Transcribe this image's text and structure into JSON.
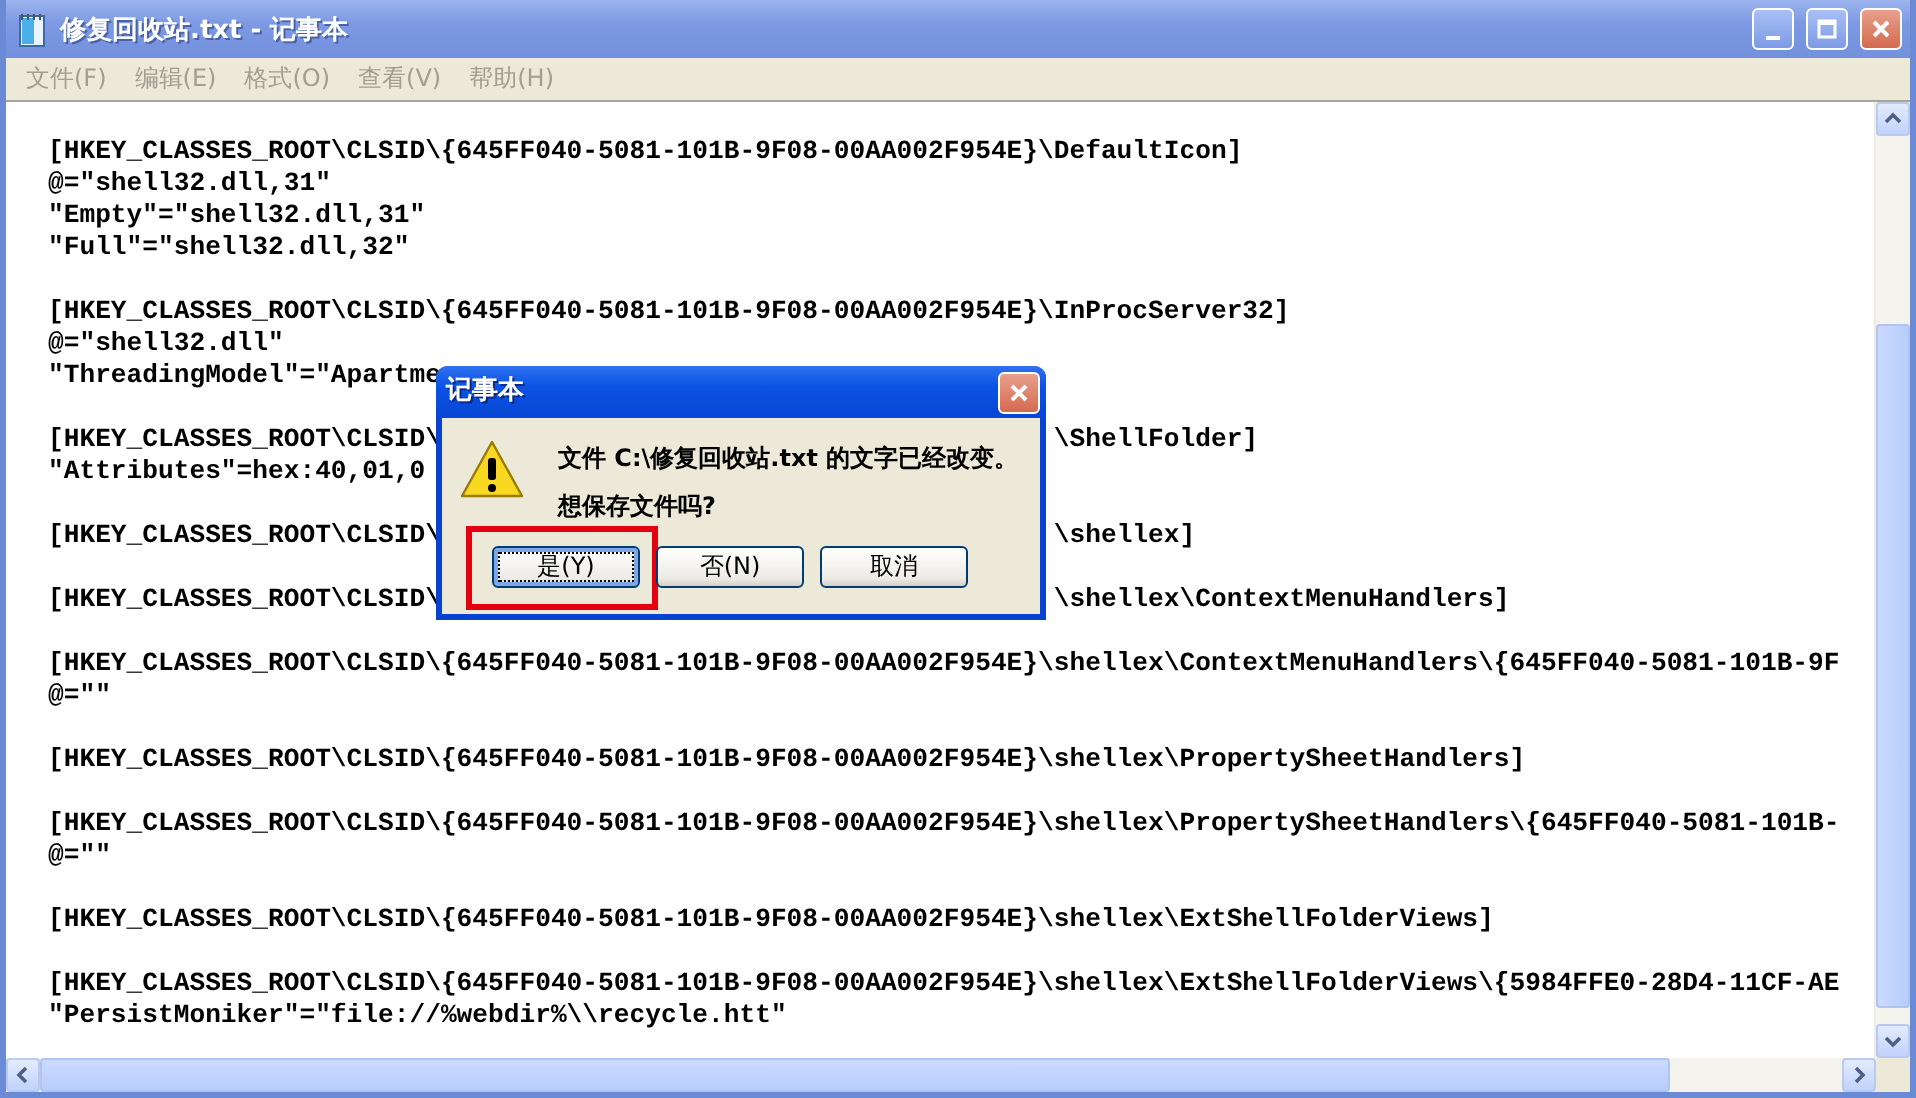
{
  "window": {
    "title": "修复回收站.txt - 记事本"
  },
  "menu": [
    {
      "label": "文件(F)"
    },
    {
      "label": "编辑(E)"
    },
    {
      "label": "格式(O)"
    },
    {
      "label": "查看(V)"
    },
    {
      "label": "帮助(H)"
    }
  ],
  "editor": {
    "lines": [
      {
        "kind": "full",
        "text": "[HKEY_CLASSES_ROOT\\CLSID\\{645FF040-5081-101B-9F08-00AA002F954E}\\DefaultIcon]"
      },
      {
        "kind": "full",
        "text": "@=\"shell32.dll,31\""
      },
      {
        "kind": "full",
        "text": "\"Empty\"=\"shell32.dll,31\""
      },
      {
        "kind": "full",
        "text": "\"Full\"=\"shell32.dll,32\""
      },
      {
        "kind": "blank"
      },
      {
        "kind": "full",
        "text": "[HKEY_CLASSES_ROOT\\CLSID\\{645FF040-5081-101B-9F08-00AA002F954E}\\InProcServer32]"
      },
      {
        "kind": "full",
        "text": "@=\"shell32.dll\""
      },
      {
        "kind": "split",
        "left": "\"ThreadingModel\"=\"Apartme"
      },
      {
        "kind": "blank"
      },
      {
        "kind": "split",
        "left": "[HKEY_CLASSES_ROOT\\CLSID\\",
        "right": "\\ShellFolder]"
      },
      {
        "kind": "split",
        "left": "\"Attributes\"=hex:40,01,0"
      },
      {
        "kind": "blank"
      },
      {
        "kind": "split",
        "left": "[HKEY_CLASSES_ROOT\\CLSID\\",
        "right": "\\shellex]"
      },
      {
        "kind": "blank"
      },
      {
        "kind": "split",
        "left": "[HKEY_CLASSES_ROOT\\CLSID\\",
        "right": "\\shellex\\ContextMenuHandlers]"
      },
      {
        "kind": "blank"
      },
      {
        "kind": "full",
        "text": "[HKEY_CLASSES_ROOT\\CLSID\\{645FF040-5081-101B-9F08-00AA002F954E}\\shellex\\ContextMenuHandlers\\{645FF040-5081-101B-9F"
      },
      {
        "kind": "full",
        "text": "@=\"\""
      },
      {
        "kind": "blank"
      },
      {
        "kind": "full",
        "text": "[HKEY_CLASSES_ROOT\\CLSID\\{645FF040-5081-101B-9F08-00AA002F954E}\\shellex\\PropertySheetHandlers]"
      },
      {
        "kind": "blank"
      },
      {
        "kind": "full",
        "text": "[HKEY_CLASSES_ROOT\\CLSID\\{645FF040-5081-101B-9F08-00AA002F954E}\\shellex\\PropertySheetHandlers\\{645FF040-5081-101B-"
      },
      {
        "kind": "full",
        "text": "@=\"\""
      },
      {
        "kind": "blank"
      },
      {
        "kind": "full",
        "text": "[HKEY_CLASSES_ROOT\\CLSID\\{645FF040-5081-101B-9F08-00AA002F954E}\\shellex\\ExtShellFolderViews]"
      },
      {
        "kind": "blank"
      },
      {
        "kind": "full",
        "text": "[HKEY_CLASSES_ROOT\\CLSID\\{645FF040-5081-101B-9F08-00AA002F954E}\\shellex\\ExtShellFolderViews\\{5984FFE0-28D4-11CF-AE"
      },
      {
        "kind": "full",
        "text": "\"PersistMoniker\"=\"file://%webdir%\\\\recycle.htt\""
      }
    ]
  },
  "dialog": {
    "title": "记事本",
    "message": [
      "文件 C:\\修复回收站.txt 的文字已经改变。",
      "想保存文件吗?"
    ],
    "buttons": [
      {
        "label": "是(Y)",
        "focused": true,
        "highlighted": true
      },
      {
        "label": "否(N)",
        "focused": false,
        "highlighted": false
      },
      {
        "label": "取消",
        "focused": false,
        "highlighted": false
      }
    ]
  }
}
